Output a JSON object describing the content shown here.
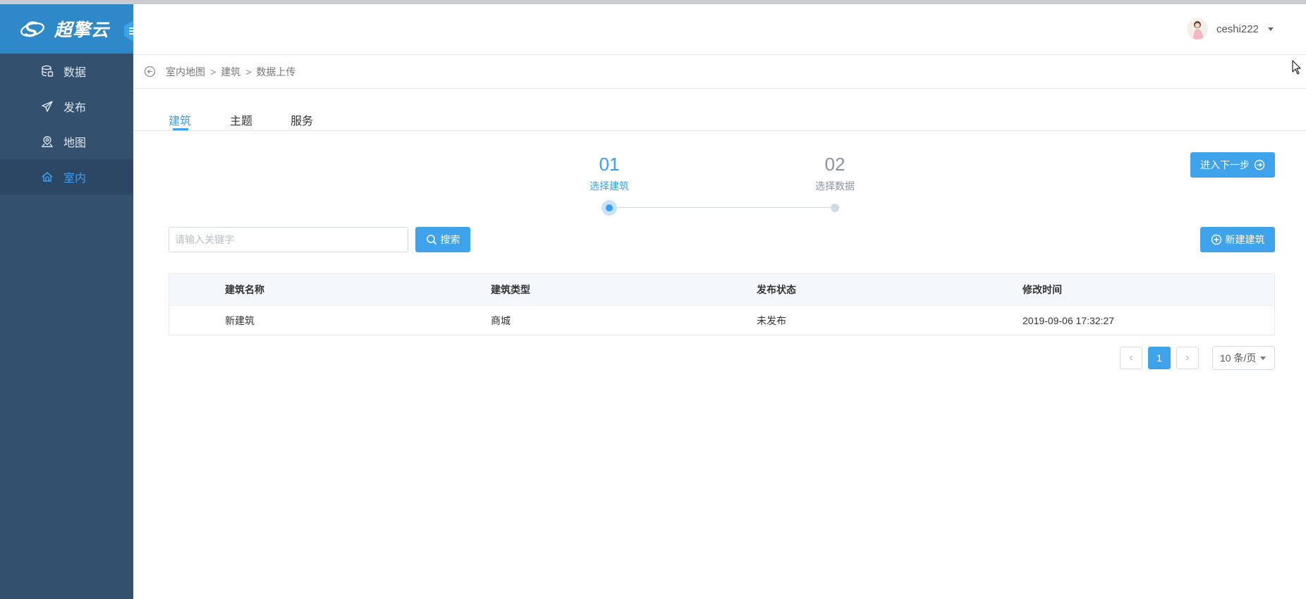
{
  "app": {
    "brand": "超擎云"
  },
  "sidebar": {
    "items": [
      {
        "label": "数据",
        "icon": "database-icon",
        "active": false
      },
      {
        "label": "发布",
        "icon": "paper-plane-icon",
        "active": false
      },
      {
        "label": "地图",
        "icon": "map-pin-icon",
        "active": false
      },
      {
        "label": "室内",
        "icon": "home-icon",
        "active": true
      }
    ]
  },
  "header": {
    "username": "ceshi222"
  },
  "breadcrumb": {
    "items": [
      "室内地图",
      "建筑",
      "数据上传"
    ],
    "separator": ">"
  },
  "tabs": [
    {
      "label": "建筑",
      "active": true
    },
    {
      "label": "主题",
      "active": false
    },
    {
      "label": "服务",
      "active": false
    }
  ],
  "steps": [
    {
      "num": "01",
      "label": "选择建筑",
      "active": true
    },
    {
      "num": "02",
      "label": "选择数据",
      "active": false
    }
  ],
  "next_button": {
    "label": "进入下一步"
  },
  "search": {
    "placeholder": "请输入关键字",
    "value": "",
    "button_label": "搜索"
  },
  "new_button": {
    "label": "新建建筑"
  },
  "table": {
    "columns": [
      "建筑名称",
      "建筑类型",
      "发布状态",
      "修改时间"
    ],
    "rows": [
      [
        "新建筑",
        "商城",
        "未发布",
        "2019-09-06 17:32:27"
      ]
    ]
  },
  "pagination": {
    "prev": "‹",
    "current": "1",
    "next": "›",
    "page_size": "10 条/页"
  },
  "colors": {
    "primary": "#3fa3ec",
    "sidebar": "#33506f",
    "logo_bar": "#2f88c8",
    "active_text": "#3a9ff0"
  }
}
